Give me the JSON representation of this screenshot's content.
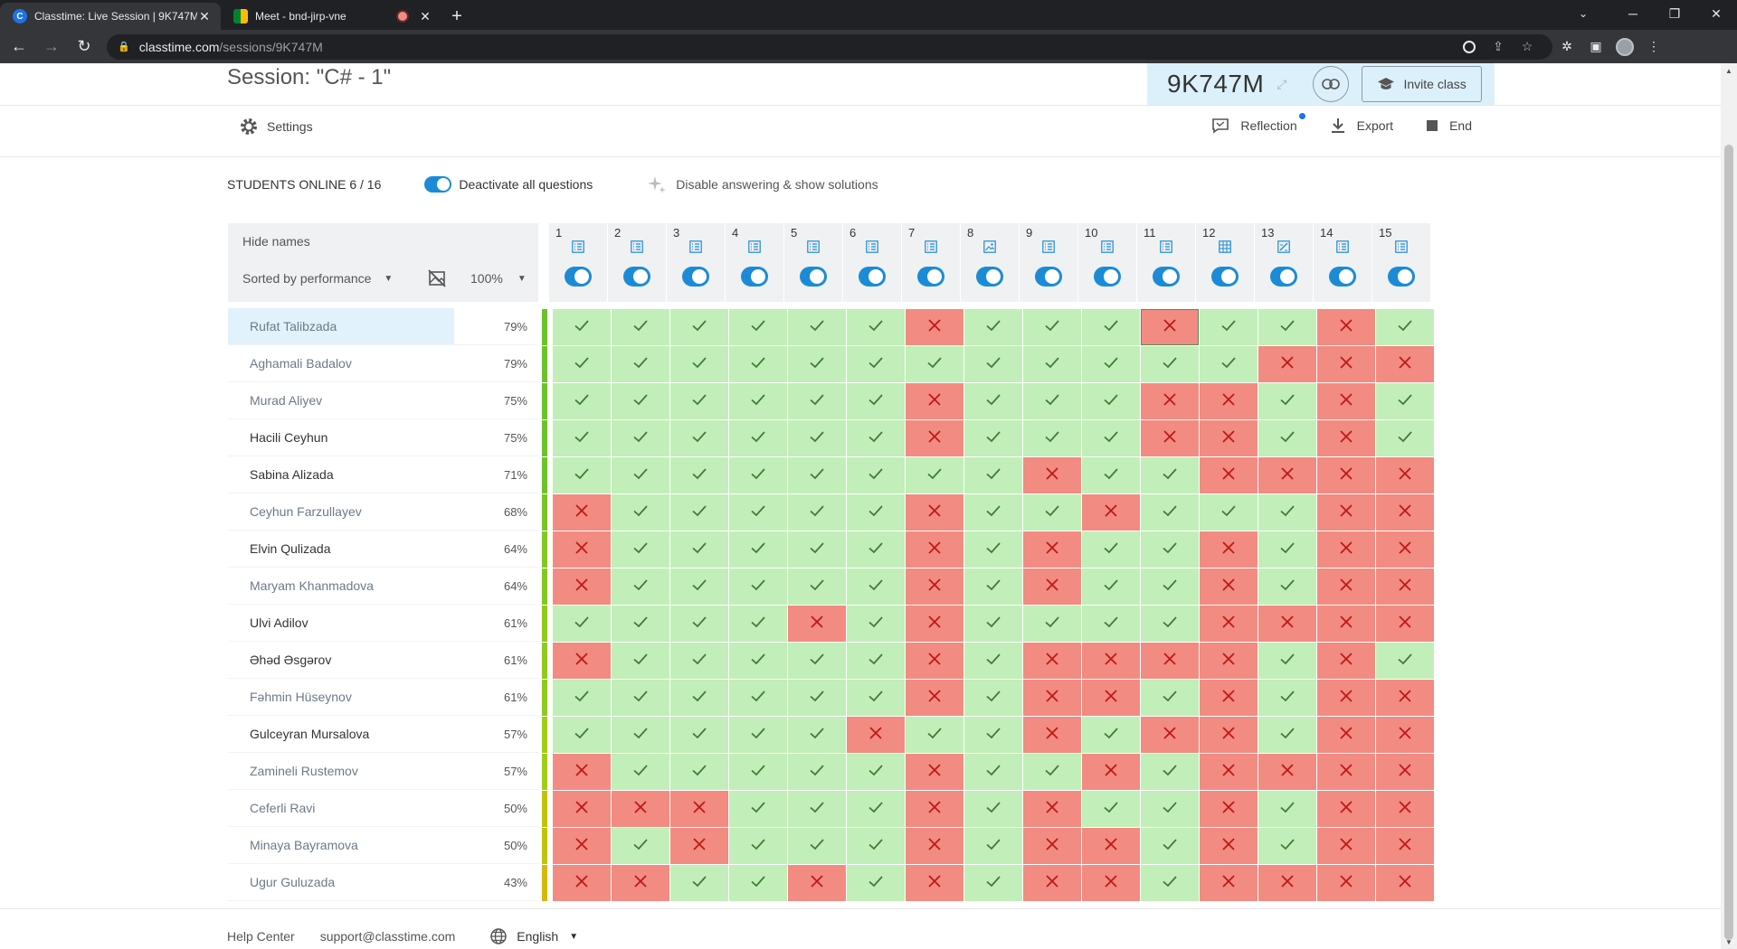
{
  "browser": {
    "tabs": [
      {
        "title": "Classtime: Live Session | 9K747M",
        "active": true,
        "icon": "classtime-favicon"
      },
      {
        "title": "Meet - bnd-jirp-vne",
        "active": false,
        "icon": "meet-favicon",
        "recording": true
      }
    ],
    "url_domain": "classtime.com",
    "url_path": "/sessions/9K747M"
  },
  "session": {
    "title": "Session: \"C# - 1\"",
    "code": "9K747M",
    "invite_label": "Invite class"
  },
  "toolbar": {
    "settings_label": "Settings",
    "reflection_label": "Reflection",
    "export_label": "Export",
    "end_label": "End"
  },
  "status": {
    "students_online": "STUDENTS ONLINE 6 / 16",
    "deactivate_label": "Deactivate all questions",
    "disable_label": "Disable answering & show solutions"
  },
  "grid_header": {
    "hide_names": "Hide names",
    "sort_label": "Sorted by performance",
    "percent_filter": "100%"
  },
  "questions": [
    {
      "num": "1",
      "icon": "list-icon"
    },
    {
      "num": "2",
      "icon": "list-icon"
    },
    {
      "num": "3",
      "icon": "list-icon"
    },
    {
      "num": "4",
      "icon": "list-icon"
    },
    {
      "num": "5",
      "icon": "list-icon"
    },
    {
      "num": "6",
      "icon": "list-icon"
    },
    {
      "num": "7",
      "icon": "list-icon"
    },
    {
      "num": "8",
      "icon": "image-question-icon"
    },
    {
      "num": "9",
      "icon": "list-icon"
    },
    {
      "num": "10",
      "icon": "list-icon"
    },
    {
      "num": "11",
      "icon": "list-icon"
    },
    {
      "num": "12",
      "icon": "table-icon"
    },
    {
      "num": "13",
      "icon": "edit-question-icon"
    },
    {
      "num": "14",
      "icon": "list-icon"
    },
    {
      "num": "15",
      "icon": "list-icon"
    }
  ],
  "students": [
    {
      "name": "Rufat Talibzada",
      "score": "79%",
      "online": false,
      "selected": true,
      "bar": "#6cc22b",
      "results": "111111011101101"
    },
    {
      "name": "Aghamali Badalov",
      "score": "79%",
      "online": false,
      "bar": "#6cc22b",
      "results": "111111111111000"
    },
    {
      "name": "Murad Aliyev",
      "score": "75%",
      "online": false,
      "bar": "#6cc22b",
      "results": "111111011100101"
    },
    {
      "name": "Hacili Ceyhun",
      "score": "75%",
      "online": true,
      "bar": "#6cc22b",
      "results": "111111011100101"
    },
    {
      "name": "Sabina Alizada",
      "score": "71%",
      "online": true,
      "bar": "#6cc22b",
      "results": "111111110110000"
    },
    {
      "name": "Ceyhun Farzullayev",
      "score": "68%",
      "online": false,
      "bar": "#78c526",
      "results": "011111011011100"
    },
    {
      "name": "Elvin Qulizada",
      "score": "64%",
      "online": true,
      "bar": "#84c822",
      "results": "011111010110100"
    },
    {
      "name": "Maryam Khanmadova",
      "score": "64%",
      "online": false,
      "bar": "#84c822",
      "results": "011111010110100"
    },
    {
      "name": "Ulvi Adilov",
      "score": "61%",
      "online": true,
      "bar": "#8eca1f",
      "results": "111101011110000"
    },
    {
      "name": "Əhəd Əsgərov",
      "score": "61%",
      "online": true,
      "bar": "#8eca1f",
      "results": "011111010000101"
    },
    {
      "name": "Fəhmin Hüseynov",
      "score": "61%",
      "online": false,
      "bar": "#8eca1f",
      "results": "111111010010100"
    },
    {
      "name": "Gulceyran Mursalova",
      "score": "57%",
      "online": true,
      "bar": "#a2cc18",
      "results": "111110110100100"
    },
    {
      "name": "Zamineli Rustemov",
      "score": "57%",
      "online": false,
      "bar": "#a2cc18",
      "results": "011111011010000"
    },
    {
      "name": "Ceferli Ravi",
      "score": "50%",
      "online": false,
      "bar": "#c2c20e",
      "results": "000111010110100"
    },
    {
      "name": "Minaya Bayramova",
      "score": "50%",
      "online": false,
      "bar": "#c2c20e",
      "results": "010111010010100"
    },
    {
      "name": "Ugur Guluzada",
      "score": "43%",
      "online": false,
      "bar": "#d6b80c",
      "results": "001101010010000"
    }
  ],
  "footer": {
    "help": "Help Center",
    "support": "support@classtime.com",
    "language": "English"
  },
  "colors": {
    "correct": "#c2eeb9",
    "wrong": "#f28b82",
    "accent": "#1c8bd6"
  }
}
